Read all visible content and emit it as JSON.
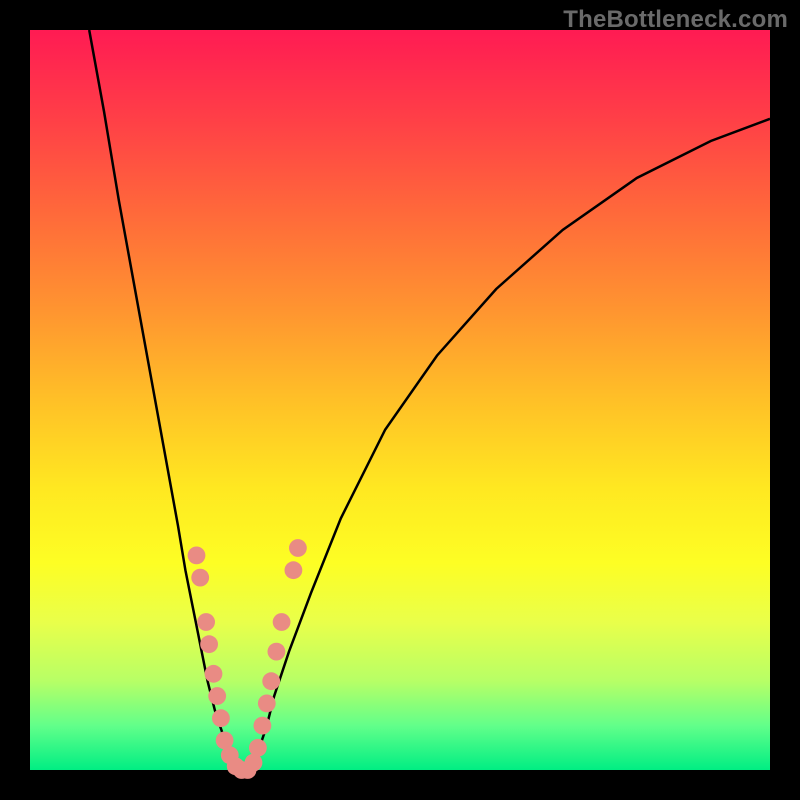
{
  "watermark": "TheBottleneck.com",
  "colors": {
    "background": "#000000",
    "curve": "#000000",
    "dots": "#e98b84",
    "gradient_top": "#ff1b53",
    "gradient_bottom": "#00ee83"
  },
  "chart_data": {
    "type": "line",
    "title": "",
    "xlabel": "",
    "ylabel": "",
    "xlim": [
      0,
      100
    ],
    "ylim": [
      0,
      100
    ],
    "series": [
      {
        "name": "left_branch",
        "x": [
          8,
          10,
          12,
          14,
          16,
          18,
          20,
          21,
          22,
          23,
          24,
          25,
          26,
          27,
          28
        ],
        "y": [
          100,
          89,
          77,
          66,
          55,
          44,
          33,
          27,
          22,
          17,
          12,
          8,
          5,
          2,
          0
        ]
      },
      {
        "name": "right_branch",
        "x": [
          30,
          31,
          32,
          33,
          35,
          38,
          42,
          48,
          55,
          63,
          72,
          82,
          92,
          100
        ],
        "y": [
          0,
          3,
          6,
          10,
          16,
          24,
          34,
          46,
          56,
          65,
          73,
          80,
          85,
          88
        ]
      }
    ],
    "scatter_overlay": {
      "name": "highlight_dots",
      "points": [
        {
          "x": 22.5,
          "y": 29
        },
        {
          "x": 23.0,
          "y": 26
        },
        {
          "x": 23.8,
          "y": 20
        },
        {
          "x": 24.2,
          "y": 17
        },
        {
          "x": 24.8,
          "y": 13
        },
        {
          "x": 25.3,
          "y": 10
        },
        {
          "x": 25.8,
          "y": 7
        },
        {
          "x": 26.3,
          "y": 4
        },
        {
          "x": 27.0,
          "y": 2
        },
        {
          "x": 27.8,
          "y": 0.5
        },
        {
          "x": 28.6,
          "y": 0
        },
        {
          "x": 29.4,
          "y": 0
        },
        {
          "x": 30.2,
          "y": 1
        },
        {
          "x": 30.8,
          "y": 3
        },
        {
          "x": 31.4,
          "y": 6
        },
        {
          "x": 32.0,
          "y": 9
        },
        {
          "x": 32.6,
          "y": 12
        },
        {
          "x": 33.3,
          "y": 16
        },
        {
          "x": 34.0,
          "y": 20
        },
        {
          "x": 35.6,
          "y": 27
        },
        {
          "x": 36.2,
          "y": 30
        }
      ],
      "radius": 1.2
    }
  }
}
